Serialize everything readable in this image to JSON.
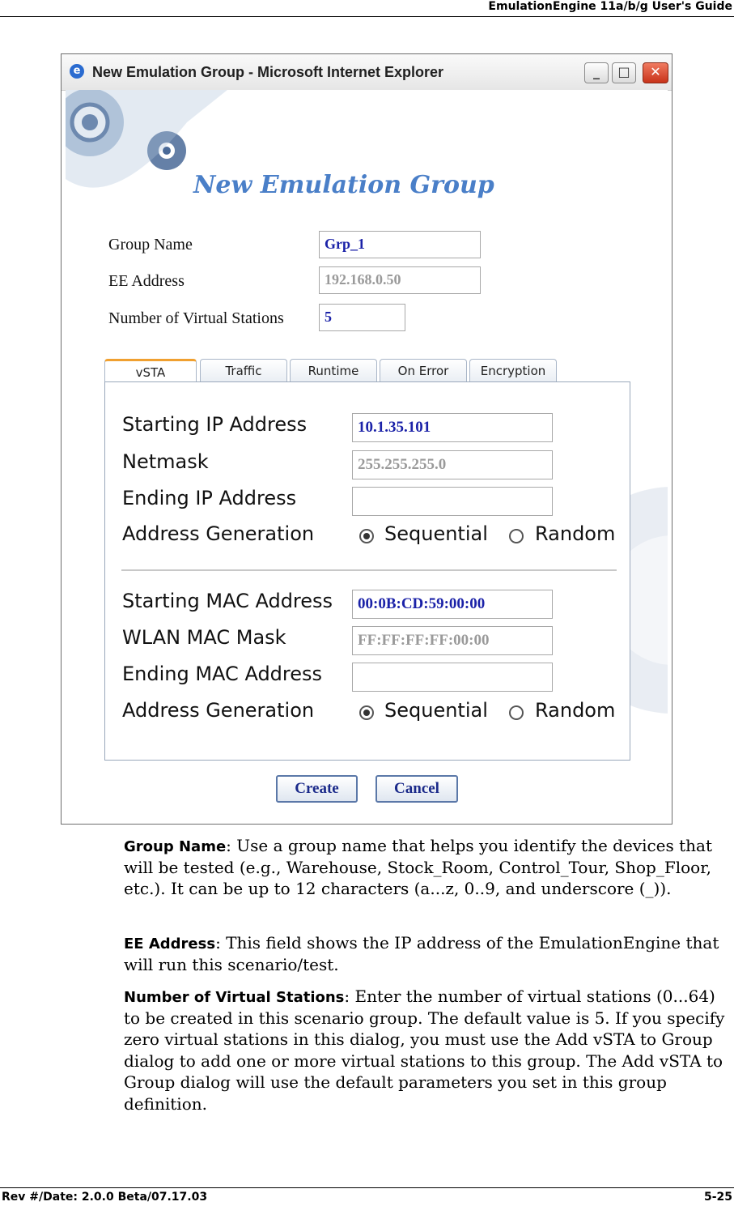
{
  "header": {
    "text": "EmulationEngine 11a/b/g User's Guide"
  },
  "window": {
    "title": "New Emulation Group - Microsoft Internet Explorer",
    "ie_icon": "e",
    "min_glyph": "_",
    "max_glyph": "□",
    "close_glyph": "✕"
  },
  "dialog": {
    "heading": "New Emulation Group",
    "group_name_label": "Group Name",
    "group_name_value": "Grp_1",
    "ee_address_label": "EE Address",
    "ee_address_value": "192.168.0.50",
    "num_stations_label": "Number of Virtual Stations",
    "num_stations_value": "5",
    "tabs": [
      "vSTA",
      "Traffic",
      "Runtime",
      "On Error",
      "Encryption"
    ],
    "panel": {
      "start_ip_label": "Starting IP Address",
      "start_ip_value": "10.1.35.101",
      "netmask_label": "Netmask",
      "netmask_value": "255.255.255.0",
      "end_ip_label": "Ending IP Address",
      "end_ip_value": "",
      "addr_gen_label": "Address Generation",
      "sequential": "Sequential",
      "random": "Random",
      "start_mac_label": "Starting MAC Address",
      "start_mac_value": "00:0B:CD:59:00:00",
      "wlan_mask_label": "WLAN MAC Mask",
      "wlan_mask_value": "FF:FF:FF:FF:00:00",
      "end_mac_label": "Ending MAC Address",
      "end_mac_value": "",
      "addr_gen2_label": "Address Generation",
      "sequential2": "Sequential",
      "random2": "Random"
    },
    "create": "Create",
    "cancel": "Cancel"
  },
  "paragraphs": {
    "p1_term": "Group Name",
    "p1_text": ": Use a group name that helps you identify the devices that will be tested (e.g., Warehouse, Stock_Room, Control_Tour, Shop_Floor, etc.). It can be up to 12 characters (a...z, 0..9, and underscore (_)).",
    "p2_term": "EE Address",
    "p2_text": ": This field shows the IP address of the EmulationEngine that will run this scenario/test.",
    "p3_term": "Number of Virtual Stations",
    "p3_text": ": Enter the number of virtual stations (0...64) to be created in this scenario group. The default value is 5. If you specify zero virtual stations in this dialog, you must use the Add vSTA to Group dialog to add one or more virtual stations to this group. The Add vSTA to Group dialog will use the default parameters you set in this group definition."
  },
  "footer": {
    "left": "Rev #/Date: 2.0.0 Beta/07.17.03",
    "right": "5-25"
  }
}
